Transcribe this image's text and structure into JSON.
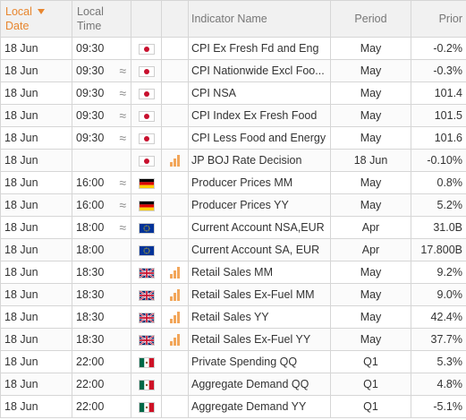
{
  "headers": {
    "local_date": [
      "Local",
      "Date"
    ],
    "local_time": [
      "Local",
      "Time"
    ],
    "indicator": "Indicator Name",
    "period": "Period",
    "prior": "Prior"
  },
  "flag_icons": {
    "jp": "japan-flag-icon",
    "de": "germany-flag-icon",
    "eu": "eu-flag-icon",
    "gb": "uk-flag-icon",
    "mx": "mexico-flag-icon"
  },
  "colors": {
    "sorted_header": "#e8862f",
    "importance_bars": "#f2a65a",
    "header_bg": "#f1f1f1",
    "grid": "#d6d6d6"
  },
  "rows": [
    {
      "date": "18 Jun",
      "time": "09:30",
      "approx": "",
      "flag": "jp",
      "importance": "",
      "name": "CPI Ex Fresh Fd and Eng",
      "period": "May",
      "prior": "-0.2%"
    },
    {
      "date": "18 Jun",
      "time": "09:30",
      "approx": "≈",
      "flag": "jp",
      "importance": "",
      "name": "CPI Nationwide Excl Foo...",
      "period": "May",
      "prior": "-0.3%"
    },
    {
      "date": "18 Jun",
      "time": "09:30",
      "approx": "≈",
      "flag": "jp",
      "importance": "",
      "name": "CPI NSA",
      "period": "May",
      "prior": "101.4"
    },
    {
      "date": "18 Jun",
      "time": "09:30",
      "approx": "≈",
      "flag": "jp",
      "importance": "",
      "name": "CPI Index Ex Fresh Food",
      "period": "May",
      "prior": "101.5"
    },
    {
      "date": "18 Jun",
      "time": "09:30",
      "approx": "≈",
      "flag": "jp",
      "importance": "",
      "name": "CPI Less Food and Energy",
      "period": "May",
      "prior": "101.6"
    },
    {
      "date": "18 Jun",
      "time": "",
      "approx": "",
      "flag": "jp",
      "importance": "high",
      "name": "JP BOJ Rate Decision",
      "period": "18 Jun",
      "prior": "-0.10%"
    },
    {
      "date": "18 Jun",
      "time": "16:00",
      "approx": "≈",
      "flag": "de",
      "importance": "",
      "name": "Producer Prices MM",
      "period": "May",
      "prior": "0.8%"
    },
    {
      "date": "18 Jun",
      "time": "16:00",
      "approx": "≈",
      "flag": "de",
      "importance": "",
      "name": "Producer Prices YY",
      "period": "May",
      "prior": "5.2%"
    },
    {
      "date": "18 Jun",
      "time": "18:00",
      "approx": "≈",
      "flag": "eu",
      "importance": "",
      "name": "Current Account NSA,EUR",
      "period": "Apr",
      "prior": "31.0B"
    },
    {
      "date": "18 Jun",
      "time": "18:00",
      "approx": "",
      "flag": "eu",
      "importance": "",
      "name": "Current Account SA, EUR",
      "period": "Apr",
      "prior": "17.800B"
    },
    {
      "date": "18 Jun",
      "time": "18:30",
      "approx": "",
      "flag": "gb",
      "importance": "high",
      "name": "Retail Sales MM",
      "period": "May",
      "prior": "9.2%"
    },
    {
      "date": "18 Jun",
      "time": "18:30",
      "approx": "",
      "flag": "gb",
      "importance": "high",
      "name": "Retail Sales Ex-Fuel MM",
      "period": "May",
      "prior": "9.0%"
    },
    {
      "date": "18 Jun",
      "time": "18:30",
      "approx": "",
      "flag": "gb",
      "importance": "high",
      "name": "Retail Sales YY",
      "period": "May",
      "prior": "42.4%"
    },
    {
      "date": "18 Jun",
      "time": "18:30",
      "approx": "",
      "flag": "gb",
      "importance": "high",
      "name": "Retail Sales Ex-Fuel YY",
      "period": "May",
      "prior": "37.7%"
    },
    {
      "date": "18 Jun",
      "time": "22:00",
      "approx": "",
      "flag": "mx",
      "importance": "",
      "name": "Private Spending QQ",
      "period": "Q1",
      "prior": "5.3%"
    },
    {
      "date": "18 Jun",
      "time": "22:00",
      "approx": "",
      "flag": "mx",
      "importance": "",
      "name": "Aggregate Demand QQ",
      "period": "Q1",
      "prior": "4.8%"
    },
    {
      "date": "18 Jun",
      "time": "22:00",
      "approx": "",
      "flag": "mx",
      "importance": "",
      "name": "Aggregate Demand YY",
      "period": "Q1",
      "prior": "-5.1%"
    }
  ]
}
